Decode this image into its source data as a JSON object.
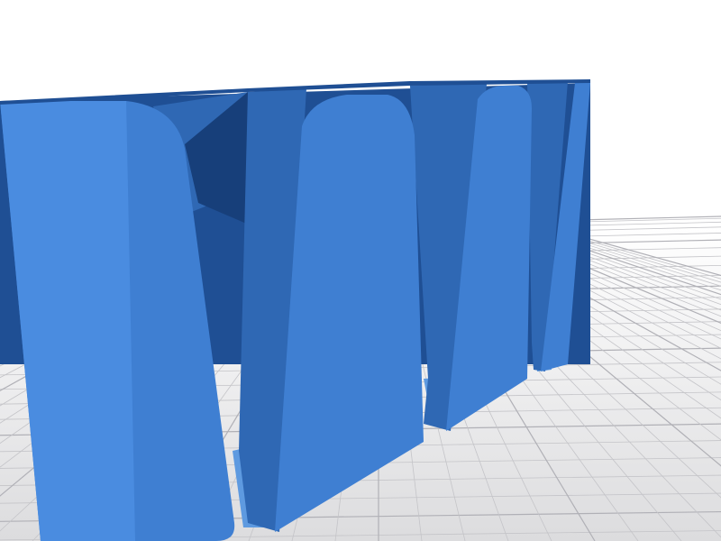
{
  "scene": {
    "subject": "3d-printed-card-holder-render",
    "colors": {
      "background_top": "#ffffff",
      "background_bottom": "#dcdcde",
      "grid_line": "#c4c4c8",
      "grid_major": "#b0b0b6",
      "model_front": "#3f7fd2",
      "model_front_light": "#4a8ce0",
      "model_side": "#2f68b4",
      "model_dark": "#1f4f94",
      "model_shadow": "#173f7a",
      "model_floor": "#5e9ae0"
    }
  }
}
